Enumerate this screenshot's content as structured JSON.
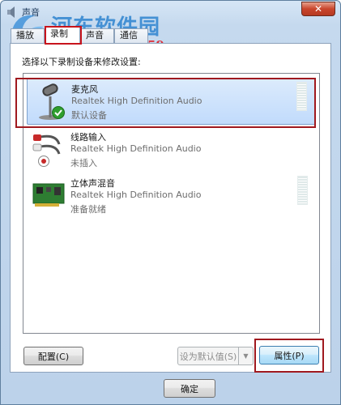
{
  "window": {
    "title": "声音",
    "close_label": "✕"
  },
  "watermark": {
    "site_name": "河东软件园",
    "url": "www.pc0359.cn"
  },
  "tabs": [
    {
      "label": "播放"
    },
    {
      "label": "录制"
    },
    {
      "label": "声音"
    },
    {
      "label": "通信"
    }
  ],
  "active_tab": "录制",
  "instruction": "选择以下录制设备来修改设置:",
  "devices": [
    {
      "name": "麦克风",
      "driver": "Realtek High Definition Audio",
      "status": "默认设备",
      "icon": "microphone-icon",
      "badge": "default-check-icon",
      "selected": true,
      "has_meter": true
    },
    {
      "name": "线路输入",
      "driver": "Realtek High Definition Audio",
      "status": "未插入",
      "icon": "line-in-cable-icon",
      "badge": "unplugged-icon",
      "selected": false,
      "has_meter": false
    },
    {
      "name": "立体声混音",
      "driver": "Realtek High Definition Audio",
      "status": "准备就绪",
      "icon": "sound-card-icon",
      "badge": "",
      "selected": false,
      "has_meter": true
    }
  ],
  "buttons": {
    "configure": "配置(C)",
    "set_default": "设为默认值(S)",
    "properties": "属性(P)",
    "ok": "确定"
  },
  "colors": {
    "highlight_red": "#a0191f",
    "selection_blue": "#c1dbfc"
  }
}
